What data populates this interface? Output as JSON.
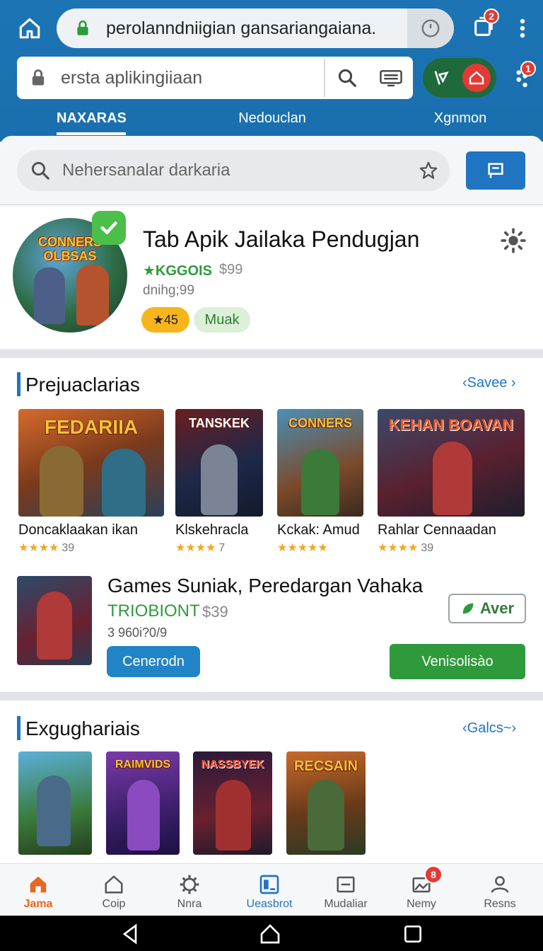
{
  "browser": {
    "url": "perolanndniigian gansariangaiana.",
    "tabs_count": "2",
    "search_placeholder": "ersta aplikingiiaan",
    "notif_count": "1"
  },
  "nav_tabs": [
    "NAXARAS",
    "Nedouclan",
    "Xgnmon"
  ],
  "main_search": {
    "placeholder": "Nehersanalar darkaria"
  },
  "featured": {
    "logo_text": "CONNERS\nOLBSAS",
    "title": "Tab Apik Jailaka Pendugjan",
    "developer": "★KGGOIS",
    "price": "$99",
    "subtitle": "dnihg;99",
    "rating": "★45",
    "tag": "Muak"
  },
  "section1": {
    "title": "Prejuaclarias",
    "link": "‹Savee ›",
    "games": [
      {
        "name": "Doncaklaakan ikan",
        "art_text": "FEDARIIA",
        "stars": "★★★★",
        "count": "39"
      },
      {
        "name": "Klskehracla",
        "art_text": "TANSKEK",
        "stars": "★★★★",
        "count": "7"
      },
      {
        "name": "Kckak: Amud",
        "art_text": "CONNERS",
        "stars": "★★★★★",
        "count": ""
      },
      {
        "name": "Rahlar Cennaadan",
        "art_text": "KEHAN  BOAVAN",
        "stars": "★★★★",
        "count": "39"
      }
    ]
  },
  "promo": {
    "title": "Games Suniak, Peredargan Vahaka",
    "developer": "TRIOBIONT",
    "price": "$39",
    "subtitle": "3 960i?0/9",
    "aver_label": "Aver",
    "left_button": "Cenerodn",
    "right_button": "Venisolisào"
  },
  "section2": {
    "title": "Exgughariais",
    "link": "‹Galcs~›",
    "tiles": [
      "",
      "RAIMVIDS",
      "NASSBYEK",
      "RECSAIN"
    ]
  },
  "bottom_nav": [
    {
      "label": "Jama"
    },
    {
      "label": "Coip"
    },
    {
      "label": "Nnra"
    },
    {
      "label": "Ueasbrot"
    },
    {
      "label": "Mudaliar"
    },
    {
      "label": "Nemy",
      "badge": "8"
    },
    {
      "label": "Resns"
    }
  ],
  "colors": {
    "header": "#1c74b4",
    "accent_blue": "#1f75c2",
    "accent_green": "#2f9a3c",
    "accent_orange": "#e8671e",
    "badge_red": "#e53935"
  }
}
